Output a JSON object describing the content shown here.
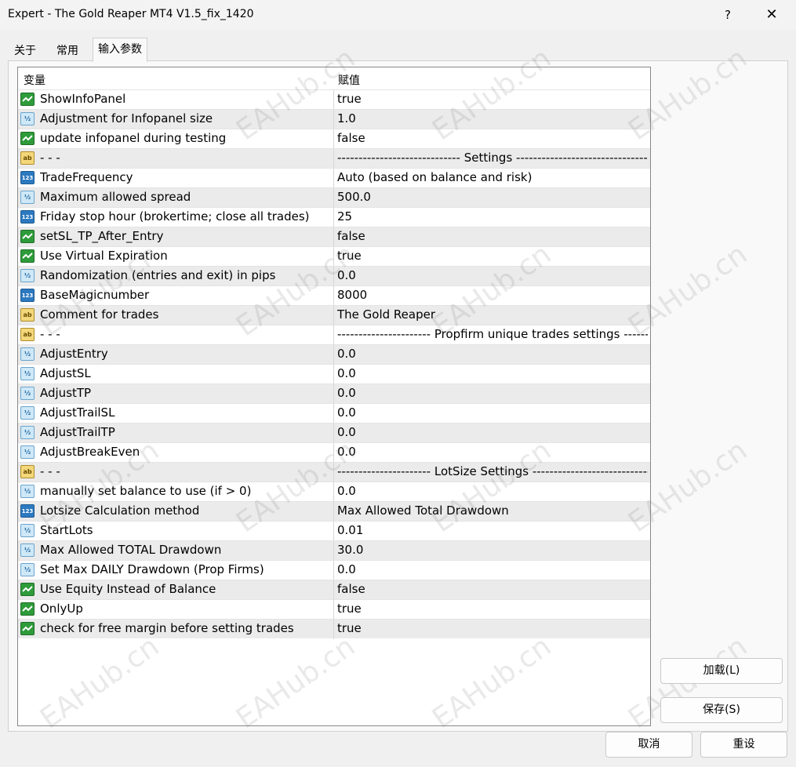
{
  "window": {
    "title": "Expert - The Gold Reaper MT4 V1.5_fix_1420",
    "help": "?",
    "close": "✕"
  },
  "tabs": [
    {
      "label": "关于"
    },
    {
      "label": "常用"
    },
    {
      "label": "输入参数"
    }
  ],
  "table": {
    "headers": {
      "name": "变量",
      "value": "赋值"
    },
    "rows": [
      {
        "type": "bool",
        "name": "ShowInfoPanel",
        "value": "true"
      },
      {
        "type": "double",
        "name": "Adjustment for Infopanel size",
        "value": "1.0"
      },
      {
        "type": "bool",
        "name": "update infopanel during testing",
        "value": "false"
      },
      {
        "type": "string",
        "name": "- - -",
        "value": "----------------------------- Settings ---------------------------------"
      },
      {
        "type": "int",
        "name": "TradeFrequency",
        "value": "Auto (based on balance and risk)"
      },
      {
        "type": "double",
        "name": "Maximum allowed spread",
        "value": "500.0"
      },
      {
        "type": "int",
        "name": "Friday stop hour (brokertime; close all trades)",
        "value": "25"
      },
      {
        "type": "bool",
        "name": "setSL_TP_After_Entry",
        "value": "false"
      },
      {
        "type": "bool",
        "name": "Use Virtual Expiration",
        "value": "true"
      },
      {
        "type": "double",
        "name": "Randomization (entries and exit) in pips",
        "value": "0.0"
      },
      {
        "type": "int",
        "name": "BaseMagicnumber",
        "value": "8000"
      },
      {
        "type": "string",
        "name": "Comment for trades",
        "value": "The Gold Reaper"
      },
      {
        "type": "string",
        "name": "- - -",
        "value": "---------------------- Propfirm unique trades settings ---------------"
      },
      {
        "type": "double",
        "name": "AdjustEntry",
        "value": "0.0"
      },
      {
        "type": "double",
        "name": "AdjustSL",
        "value": "0.0"
      },
      {
        "type": "double",
        "name": "AdjustTP",
        "value": "0.0"
      },
      {
        "type": "double",
        "name": "AdjustTrailSL",
        "value": "0.0"
      },
      {
        "type": "double",
        "name": "AdjustTrailTP",
        "value": "0.0"
      },
      {
        "type": "double",
        "name": "AdjustBreakEven",
        "value": "0.0"
      },
      {
        "type": "string",
        "name": "- - -",
        "value": "---------------------- LotSize Settings ----------------------------------"
      },
      {
        "type": "double",
        "name": "manually set balance to use (if > 0)",
        "value": "0.0"
      },
      {
        "type": "int",
        "name": "Lotsize Calculation method",
        "value": "Max Allowed Total Drawdown"
      },
      {
        "type": "double",
        "name": "StartLots",
        "value": "0.01"
      },
      {
        "type": "double",
        "name": "Max Allowed TOTAL Drawdown",
        "value": "30.0"
      },
      {
        "type": "double",
        "name": "Set Max DAILY Drawdown (Prop Firms)",
        "value": "0.0"
      },
      {
        "type": "bool",
        "name": "Use Equity Instead of Balance",
        "value": "false"
      },
      {
        "type": "bool",
        "name": "OnlyUp",
        "value": "true"
      },
      {
        "type": "bool",
        "name": "check for free margin before setting trades",
        "value": "true"
      }
    ]
  },
  "icons": {
    "bool": "bool-param-icon",
    "double": "double-param-icon",
    "int": "int-param-icon",
    "string": "string-param-icon"
  },
  "icon_glyphs": {
    "double": "½",
    "int": "123",
    "string": "ab"
  },
  "buttons": {
    "load": "加载(L)",
    "save": "保存(S)",
    "cancel": "取消",
    "reset": "重设"
  },
  "watermark": "EAHub.cn"
}
